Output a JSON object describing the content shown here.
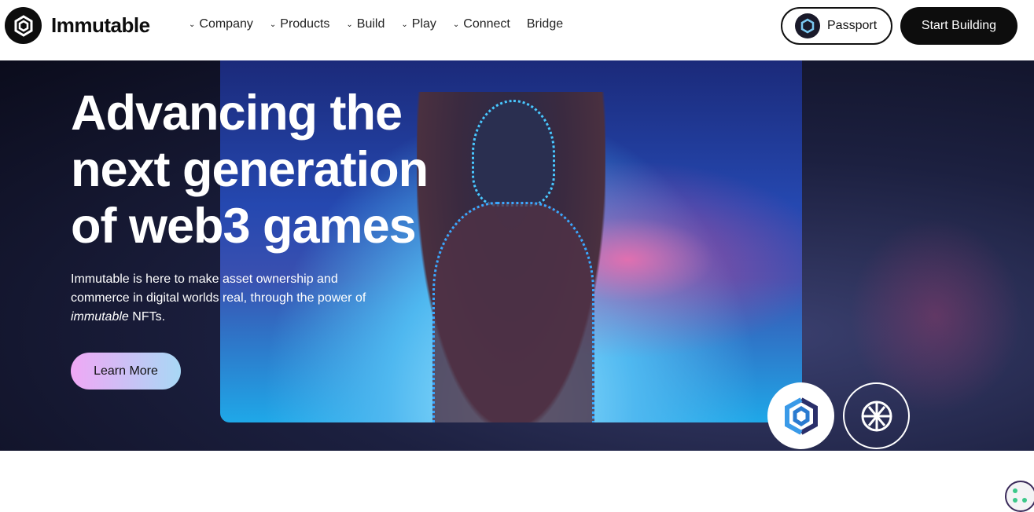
{
  "nav": {
    "brand": "Immutable",
    "menu": [
      {
        "label": "Company",
        "has_dropdown": true
      },
      {
        "label": "Products",
        "has_dropdown": true
      },
      {
        "label": "Build",
        "has_dropdown": true
      },
      {
        "label": "Play",
        "has_dropdown": true
      },
      {
        "label": "Connect",
        "has_dropdown": true
      },
      {
        "label": "Bridge",
        "has_dropdown": false
      }
    ],
    "passport_label": "Passport",
    "start_label": "Start Building"
  },
  "hero": {
    "title_lines": [
      "Advancing the",
      "next generation",
      "of web3 games"
    ],
    "sub_pre": "Immutable is here to make asset ownership and commerce in digital worlds real, through the power of ",
    "sub_em": "immutable",
    "sub_post": " NFTs.",
    "cta_label": "Learn More"
  },
  "colors": {
    "dark": "#0d0d0d",
    "cta_start": "#f0a8f5",
    "cta_end": "#a8d8f5"
  }
}
